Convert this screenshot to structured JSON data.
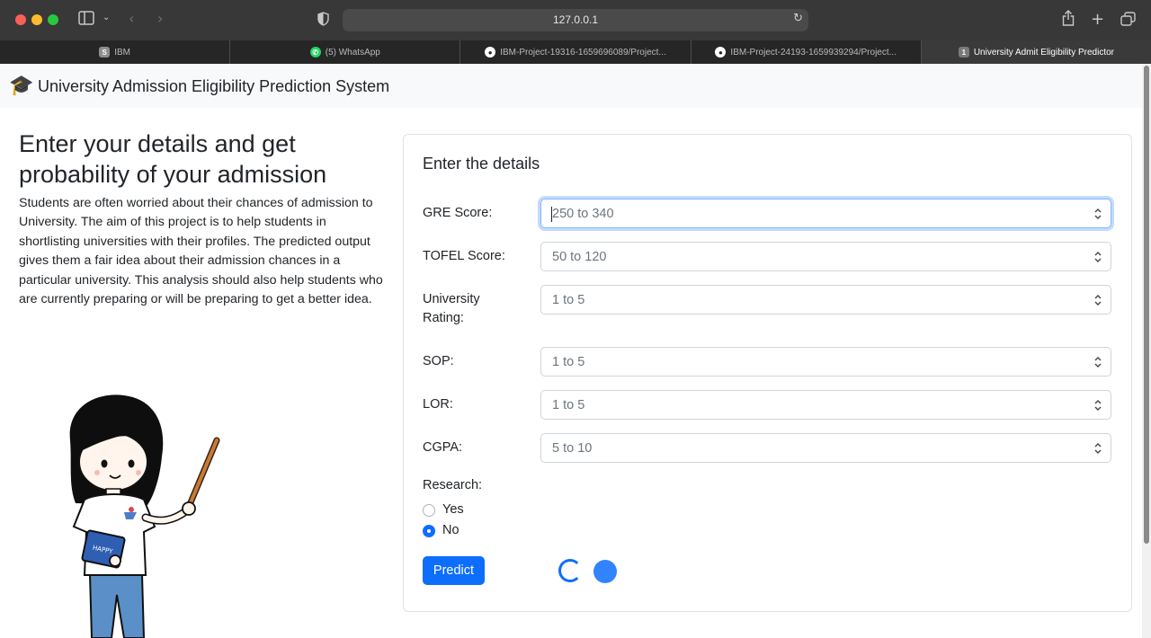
{
  "browser": {
    "url": "127.0.0.1",
    "tabs": [
      {
        "favicon": "S",
        "title": "IBM"
      },
      {
        "favicon": "whatsapp-icon",
        "title": "(5) WhatsApp"
      },
      {
        "favicon": "github-icon",
        "title": "IBM-Project-19316-1659696089/Project..."
      },
      {
        "favicon": "github-icon",
        "title": "IBM-Project-24193-1659939294/Project..."
      },
      {
        "favicon": "1",
        "title": "University Admit Eligibility Predictor"
      }
    ]
  },
  "navbar": {
    "brand_icon": "graduation-cap-icon",
    "brand": "University Admission Eligibility Prediction System"
  },
  "hero": {
    "title": "Enter your details and get probability of your admission",
    "description": "Students are often worried about their chances of admission to University. The aim of this project is to help students in shortlisting universities with their profiles. The predicted output gives them a fair idea about their admission chances in a particular university. This analysis should also help students who are currently preparing or will be preparing to get a better idea."
  },
  "form": {
    "title": "Enter the details",
    "fields": [
      {
        "label": "GRE Score:",
        "placeholder": "250 to 340"
      },
      {
        "label": "TOFEL Score:",
        "placeholder": "50 to 120"
      },
      {
        "label": "University Rating:",
        "placeholder": "1 to 5"
      },
      {
        "label": "SOP:",
        "placeholder": "1 to 5"
      },
      {
        "label": "LOR:",
        "placeholder": "1 to 5"
      },
      {
        "label": "CGPA:",
        "placeholder": "5 to 10"
      }
    ],
    "research": {
      "label": "Research:",
      "options": [
        {
          "label": "Yes",
          "checked": false
        },
        {
          "label": "No",
          "checked": true
        }
      ]
    },
    "submit_label": "Predict"
  },
  "colors": {
    "primary": "#0d6efd",
    "navbar_bg": "#f8f9fa",
    "text": "#212529",
    "placeholder": "#6c757d"
  }
}
